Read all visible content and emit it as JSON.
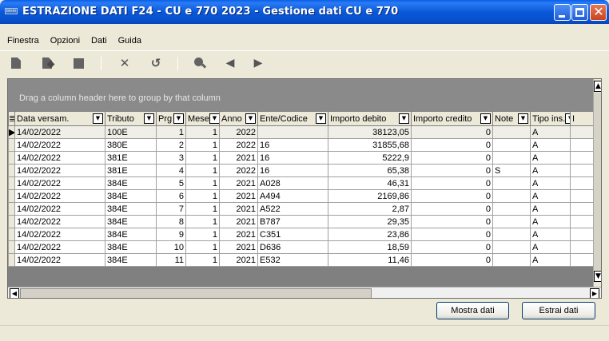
{
  "window": {
    "icon_text": "timm",
    "title": "ESTRAZIONE DATI F24 - CU e 770 2023 - Gestione dati CU e 770"
  },
  "menu": [
    "Finestra",
    "Opzioni",
    "Dati",
    "Guida"
  ],
  "toolbar": {
    "icons": [
      "new-icon",
      "edit-icon",
      "save-icon",
      "delete-icon",
      "undo-icon",
      "find-icon",
      "previous-icon",
      "next-icon"
    ]
  },
  "grid": {
    "group_hint": "Drag a column header here to group by that column",
    "columns": [
      "Data versam.",
      "Tributo",
      "Prg",
      "Mese",
      "Anno",
      "Ente/Codice",
      "Importo debito",
      "Importo credito",
      "Note",
      "Tipo ins.",
      "I"
    ],
    "rows": [
      [
        "14/02/2022",
        "100E",
        "1",
        "1",
        "2022",
        "",
        "38123,05",
        "0",
        "",
        "A"
      ],
      [
        "14/02/2022",
        "380E",
        "2",
        "1",
        "2022",
        "16",
        "31855,68",
        "0",
        "",
        "A"
      ],
      [
        "14/02/2022",
        "381E",
        "3",
        "1",
        "2021",
        "16",
        "5222,9",
        "0",
        "",
        "A"
      ],
      [
        "14/02/2022",
        "381E",
        "4",
        "1",
        "2022",
        "16",
        "65,38",
        "0",
        "S",
        "A"
      ],
      [
        "14/02/2022",
        "384E",
        "5",
        "1",
        "2021",
        "A028",
        "46,31",
        "0",
        "",
        "A"
      ],
      [
        "14/02/2022",
        "384E",
        "6",
        "1",
        "2021",
        "A494",
        "2169,86",
        "0",
        "",
        "A"
      ],
      [
        "14/02/2022",
        "384E",
        "7",
        "1",
        "2021",
        "A522",
        "2,87",
        "0",
        "",
        "A"
      ],
      [
        "14/02/2022",
        "384E",
        "8",
        "1",
        "2021",
        "B787",
        "29,35",
        "0",
        "",
        "A"
      ],
      [
        "14/02/2022",
        "384E",
        "9",
        "1",
        "2021",
        "C351",
        "23,86",
        "0",
        "",
        "A"
      ],
      [
        "14/02/2022",
        "384E",
        "10",
        "1",
        "2021",
        "D636",
        "18,59",
        "0",
        "",
        "A"
      ],
      [
        "14/02/2022",
        "384E",
        "11",
        "1",
        "2021",
        "E532",
        "11,46",
        "0",
        "",
        "A"
      ]
    ]
  },
  "buttons": {
    "show": "Mostra dati",
    "extract": "Estrai dati"
  }
}
